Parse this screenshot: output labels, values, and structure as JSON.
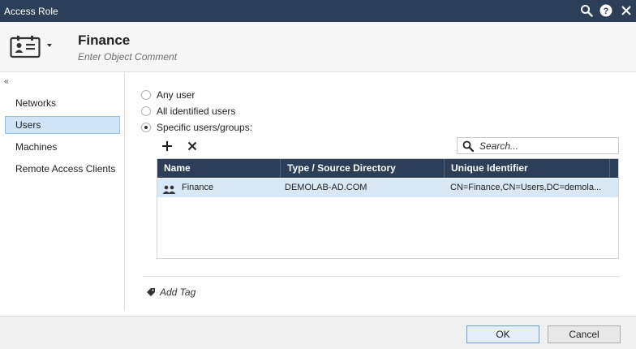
{
  "window": {
    "title": "Access Role",
    "icons": [
      "search-icon",
      "help-icon",
      "close-icon"
    ]
  },
  "header": {
    "name": "Finance",
    "comment_placeholder": "Enter Object Comment",
    "icon": "id-card-icon"
  },
  "sidebar": {
    "collapse_glyph": "«",
    "items": [
      {
        "label": "Networks",
        "selected": false
      },
      {
        "label": "Users",
        "selected": true
      },
      {
        "label": "Machines",
        "selected": false
      },
      {
        "label": "Remote Access Clients",
        "selected": false
      }
    ]
  },
  "users": {
    "options": [
      {
        "label": "Any user",
        "checked": false
      },
      {
        "label": "All identified users",
        "checked": false
      },
      {
        "label": "Specific users/groups:",
        "checked": true
      }
    ],
    "toolbar": {
      "add_glyph": "+",
      "remove_glyph": "✕"
    },
    "search": {
      "placeholder": "Search..."
    },
    "table": {
      "columns": [
        "Name",
        "Type / Source Directory",
        "Unique Identifier"
      ],
      "rows": [
        {
          "icon": "group-icon",
          "name": "Finance",
          "type": "DEMOLAB-AD.COM",
          "uid": "CN=Finance,CN=Users,DC=demola..."
        }
      ]
    }
  },
  "tags": {
    "add_label": "Add Tag"
  },
  "footer": {
    "ok_label": "OK",
    "cancel_label": "Cancel"
  },
  "colors": {
    "titlebar": "#2c3e58",
    "selection": "#cfe4f7",
    "row_highlight": "#d9e8f6"
  }
}
